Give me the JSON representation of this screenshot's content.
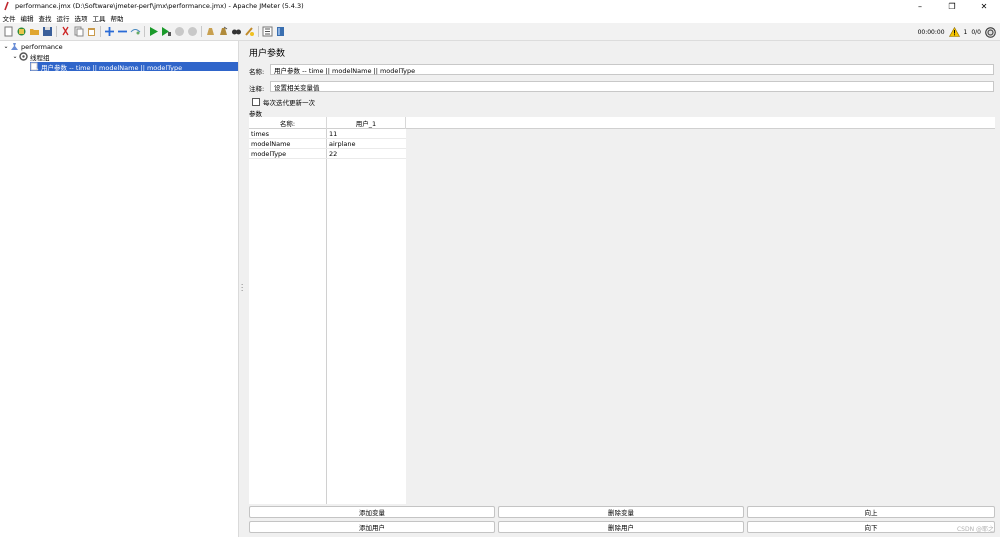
{
  "window": {
    "title": "performance.jmx (D:\\Software\\jmeter-perf\\jmx\\performance.jmx) - Apache JMeter (5.4.3)",
    "minimize": "–",
    "maximize": "❐",
    "close": "✕"
  },
  "menu": [
    "文件",
    "编辑",
    "查找",
    "运行",
    "选项",
    "工具",
    "帮助"
  ],
  "toolbar": {
    "icons": [
      "new-icon",
      "templates-icon",
      "open-icon",
      "save-icon",
      "cut-icon",
      "copy-icon",
      "paste-icon",
      "expand-icon",
      "collapse-icon",
      "toggle-icon",
      "start-icon",
      "start-no-pause-icon",
      "stop-icon",
      "shutdown-icon",
      "clear-icon",
      "clear-all-icon",
      "search-icon",
      "reset-search-icon",
      "function-helper-icon",
      "help-icon"
    ],
    "timer": "00:00:00",
    "warning_count": "1",
    "threads": "0/0"
  },
  "tree": {
    "items": [
      {
        "label": "performance",
        "level": 0
      },
      {
        "label": "线程组",
        "level": 1
      },
      {
        "label": "用户参数 -- time || modelName || modelType",
        "level": 2
      }
    ]
  },
  "panel": {
    "title": "用户参数",
    "name_label": "名称:",
    "name_value": "用户参数 -- time || modelName || modelType",
    "comment_label": "注释:",
    "comment_value": "设置相关变量值",
    "checkbox_label": "每次迭代更新一次",
    "params_label": "参数",
    "table": {
      "headers": [
        "名称:",
        "用户_1"
      ],
      "rows": [
        [
          "times",
          "11"
        ],
        [
          "modelName",
          "airplane"
        ],
        [
          "modelType",
          "22"
        ]
      ]
    },
    "buttons": {
      "add_var": "添加变量",
      "delete_var": "删除变量",
      "up": "向上",
      "add_user": "添加用户",
      "delete_user": "删除用户",
      "down": "向下"
    }
  },
  "watermark": "CSDN @耶之",
  "colors": {
    "selection": "#2f65ca",
    "panel_bg": "#f0f0f0",
    "start_green": "#1a9a2a",
    "warning_yellow": "#f5c400"
  }
}
